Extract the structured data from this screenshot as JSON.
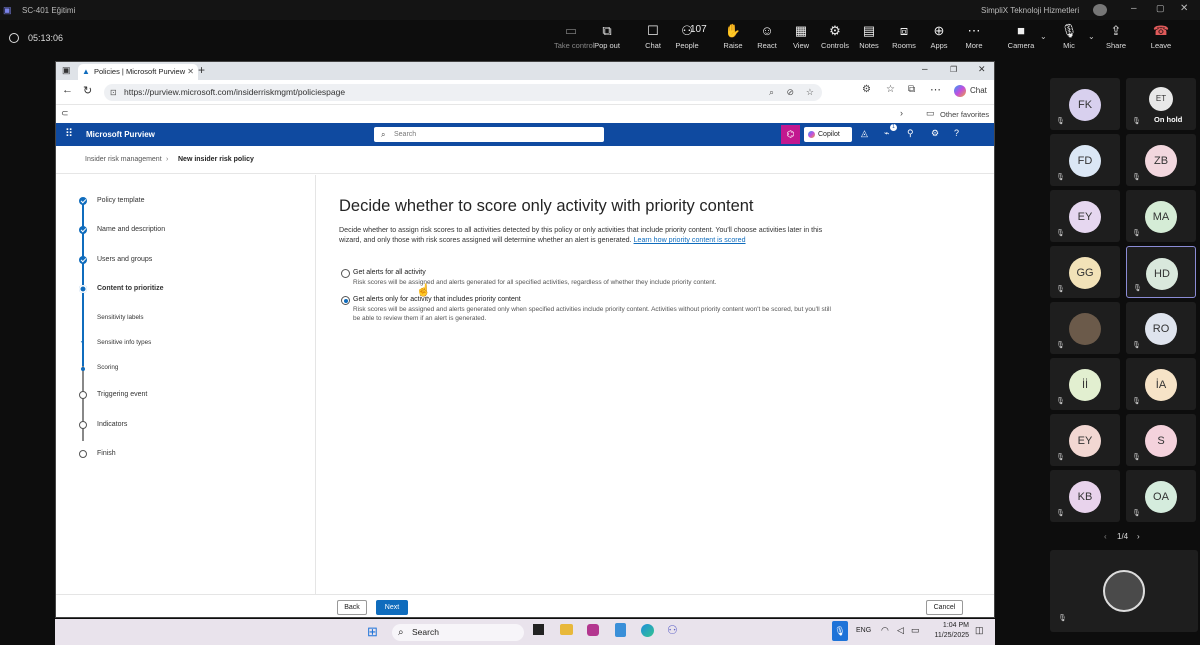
{
  "teams": {
    "app_title": "SC-401 Eğitimi",
    "timer": "05:13:06",
    "org": "SimpliX Teknoloji Hizmetleri",
    "toolbar": [
      {
        "label": "Take control",
        "icon": "take-control-icon",
        "glyph": "▭"
      },
      {
        "label": "Pop out",
        "icon": "pop-out-icon",
        "glyph": "⧉"
      },
      {
        "label": "Chat",
        "icon": "chat-icon",
        "glyph": "☐"
      },
      {
        "label": "People",
        "icon": "people-icon",
        "glyph": "⚇"
      },
      {
        "label": "Raise",
        "icon": "raise-hand-icon",
        "glyph": "✋"
      },
      {
        "label": "React",
        "icon": "react-icon",
        "glyph": "☺"
      },
      {
        "label": "View",
        "icon": "view-icon",
        "glyph": "▦"
      },
      {
        "label": "Controls",
        "icon": "controls-icon",
        "glyph": "⚙"
      },
      {
        "label": "Notes",
        "icon": "notes-icon",
        "glyph": "▤"
      },
      {
        "label": "Rooms",
        "icon": "rooms-icon",
        "glyph": "⧈"
      },
      {
        "label": "Apps",
        "icon": "apps-icon",
        "glyph": "⊕"
      },
      {
        "label": "More",
        "icon": "more-icon",
        "glyph": "⋯"
      }
    ],
    "people_count": "107",
    "camera_label": "Camera",
    "mic_label": "Mic",
    "share_label": "Share",
    "leave_label": "Leave",
    "participants": [
      {
        "initials": "FK",
        "color": "#d8d0ee"
      },
      {
        "initials": "ET",
        "color": "#e8e8e8",
        "status": "On hold"
      },
      {
        "initials": "FD",
        "color": "#dbe7f5"
      },
      {
        "initials": "ZB",
        "color": "#f2d7de"
      },
      {
        "initials": "EY",
        "color": "#e6d7f0"
      },
      {
        "initials": "MA",
        "color": "#d5ecd6"
      },
      {
        "initials": "GG",
        "color": "#f2e2b8"
      },
      {
        "initials": "HD",
        "color": "#d9e8dc"
      },
      {
        "initials": "",
        "color": "#6b5a4a"
      },
      {
        "initials": "RO",
        "color": "#dfe4ee"
      },
      {
        "initials": "İİ",
        "color": "#e2efd0"
      },
      {
        "initials": "İA",
        "color": "#f6e3c7"
      },
      {
        "initials": "EY",
        "color": "#f2d7d2"
      },
      {
        "initials": "S",
        "color": "#f4d2dc"
      },
      {
        "initials": "KB",
        "color": "#e8d3ec"
      },
      {
        "initials": "OA",
        "color": "#d5ecdd"
      }
    ],
    "page_indicator": "1/4"
  },
  "browser": {
    "tab_title": "Policies | Microsoft Purview",
    "url": "https://purview.microsoft.com/insiderriskmgmt/policiespage",
    "chat_label": "Chat",
    "other_favorites": "Other favorites"
  },
  "purview": {
    "brand": "Microsoft Purview",
    "search_placeholder": "Search",
    "copilot_label": "Copilot",
    "notification_count": "1",
    "breadcrumb": [
      "Insider risk management",
      "New insider risk policy"
    ],
    "steps": [
      {
        "label": "Policy template",
        "state": "done"
      },
      {
        "label": "Name and description",
        "state": "done"
      },
      {
        "label": "Users and groups",
        "state": "done"
      },
      {
        "label": "Content to prioritize",
        "state": "current"
      },
      {
        "label": "Sensitivity labels",
        "state": "sub"
      },
      {
        "label": "Sensitive info types",
        "state": "sub-done"
      },
      {
        "label": "Scoring",
        "state": "sub-current"
      },
      {
        "label": "Triggering event",
        "state": "todo"
      },
      {
        "label": "Indicators",
        "state": "todo"
      },
      {
        "label": "Finish",
        "state": "todo"
      }
    ],
    "heading": "Decide whether to score only activity with priority content",
    "description": "Decide whether to assign risk scores to all activities detected by this policy or only activities that include priority content. You'll choose activities later in this wizard, and only those with risk scores assigned will determine whether an alert is generated.",
    "learn_link": "Learn how priority content is scored",
    "options": [
      {
        "label": "Get alerts for all activity",
        "desc": "Risk scores will be assigned and alerts generated for all specified activities, regardless of whether they include priority content.",
        "selected": false
      },
      {
        "label": "Get alerts only for activity that includes priority content",
        "desc": "Risk scores will be assigned and alerts generated only when specified activities include priority content. Activities without priority content won't be scored, but you'll still be able to review them if an alert is generated.",
        "selected": true
      }
    ],
    "back_label": "Back",
    "next_label": "Next",
    "cancel_label": "Cancel"
  },
  "taskbar": {
    "search_label": "Search",
    "language": "ENG",
    "time": "1:04 PM",
    "date": "11/25/2025"
  }
}
